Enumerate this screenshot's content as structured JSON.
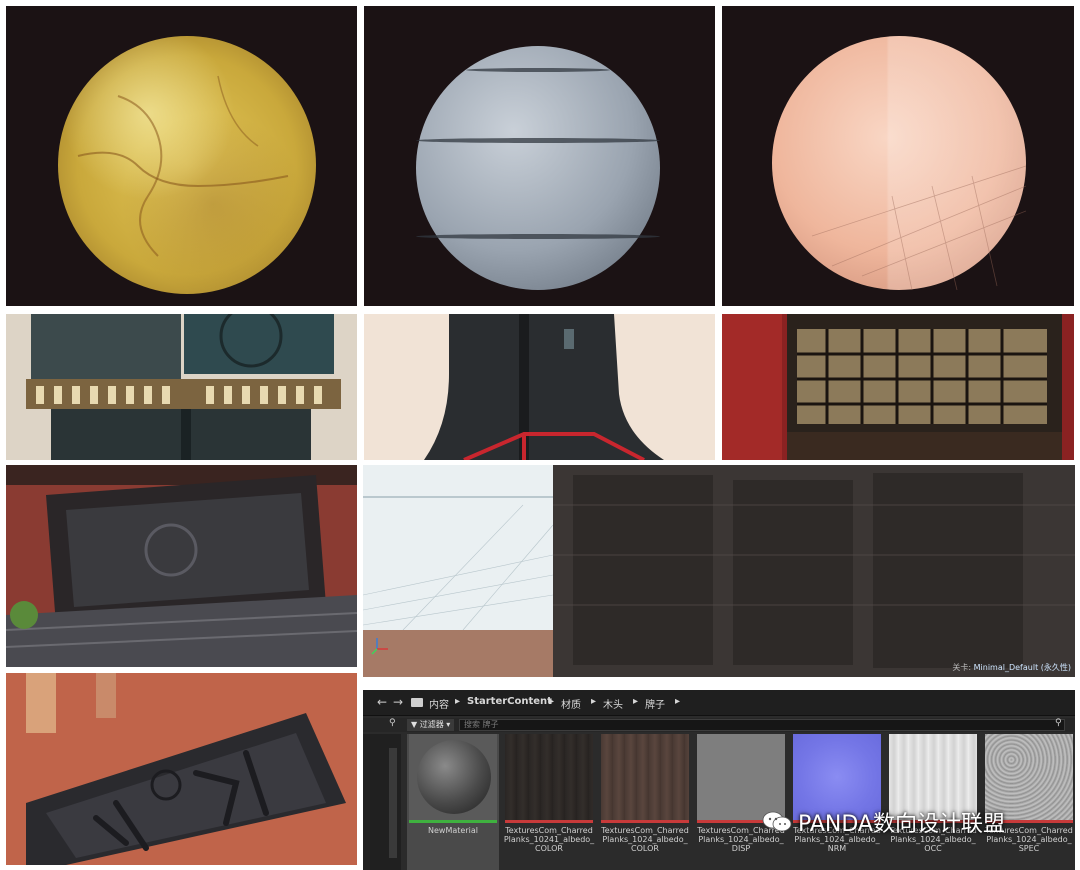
{
  "colors": {
    "panel_dark": "#1b1214",
    "ue_bg": "#2b2b2b",
    "selected_underline": "#3fb13f",
    "texture_underline": "#c83a3a"
  },
  "viewport": {
    "status_prefix": "关卡:",
    "status_level": "Minimal_Default (永久性)"
  },
  "browser": {
    "nav_back_icon": "arrow-left-icon",
    "nav_forward_icon": "arrow-right-icon",
    "breadcrumb": [
      "内容",
      "StarterContent",
      "材质",
      "木头",
      "牌子"
    ],
    "filter_label": "过滤器",
    "search_placeholder": "搜索 牌子",
    "assets": [
      {
        "label": "NewMaterial",
        "type": "material"
      },
      {
        "label": "TexturesCom_Charred\nPlanks_10241_albedo_\nCOLOR",
        "type": "texture"
      },
      {
        "label": "TexturesCom_Charred\nPlanks_1024_albedo_\nCOLOR",
        "type": "texture"
      },
      {
        "label": "TexturesCom_Charred\nPlanks_1024_albedo_\nDISP",
        "type": "texture"
      },
      {
        "label": "TexturesCom_Charred\nPlanks_1024_albedo_\nNRM",
        "type": "texture"
      },
      {
        "label": "TexturesCom_Charred\nPlanks_1024_albedo_\nOCC",
        "type": "texture"
      },
      {
        "label": "TexturesCom_Charred\nPlanks_1024_albedo_\nSPEC",
        "type": "texture"
      }
    ]
  },
  "watermark": {
    "icon": "wechat-icon",
    "text": "PANDA数向设计联盟"
  }
}
